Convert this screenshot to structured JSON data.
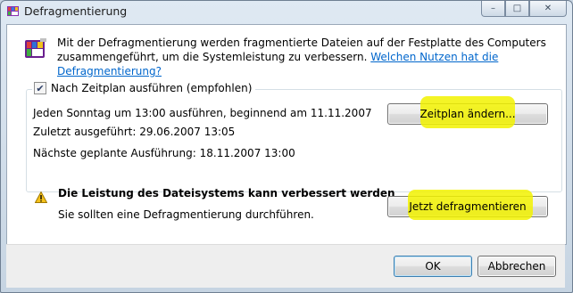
{
  "window": {
    "title": "Defragmentierung",
    "caption_buttons": {
      "minimize": "–",
      "maximize": "□",
      "close": "✕"
    }
  },
  "intro": {
    "text": "Mit der Defragmentierung werden fragmentierte Dateien auf der Festplatte des Computers zusammengeführt, um die Systemleistung zu verbessern.",
    "link": "Welchen Nutzen hat die Defragmentierung?"
  },
  "schedule": {
    "checkbox_label": "Nach Zeitplan ausführen (empfohlen)",
    "checked": true,
    "check_glyph": "✔",
    "line1": "Jeden Sonntag um 13:00 ausführen, beginnend am 11.11.2007",
    "line2": "Zuletzt ausgeführt: 29.06.2007 13:05",
    "line3": "Nächste geplante Ausführung: 18.11.2007 13:00",
    "button": "Zeitplan ändern..."
  },
  "status": {
    "headline": "Die Leistung des Dateisystems kann verbessert werden",
    "detail": "Sie sollten eine Defragmentierung durchführen.",
    "button": "Jetzt defragmentieren",
    "highlight_color": "#f2f200"
  },
  "footer": {
    "ok": "OK",
    "cancel": "Abbrechen"
  },
  "icons": {
    "app": "defrag-icon",
    "warning": "warning-icon"
  }
}
